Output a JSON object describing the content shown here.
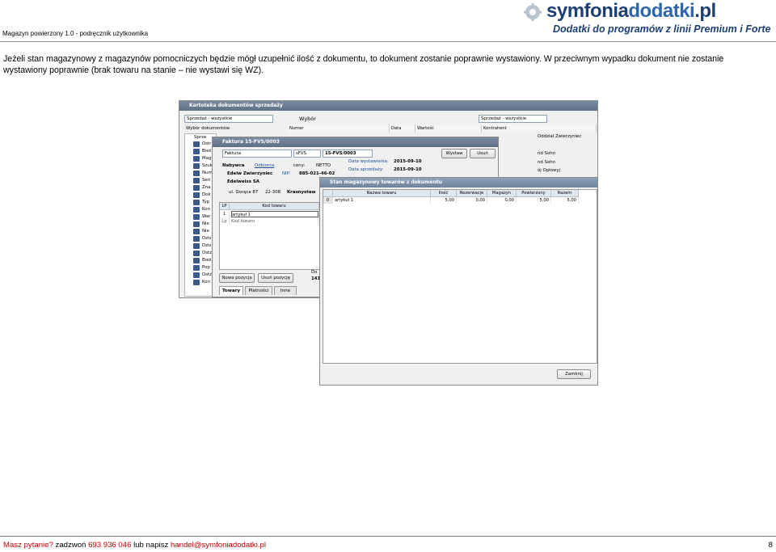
{
  "header": {
    "left_text": "Magazyn powierzony 1.0  - podręcznik użytkownika",
    "logo_main": "symfonia",
    "logo_accent": "dodatki",
    "logo_tld": ".pl",
    "logo_tagline": "Dodatki do programów z linii Premium i Forte"
  },
  "body": {
    "paragraph": "Jeżeli stan magazynowy z magazynów pomocniczych będzie mógł uzupełnić ilość z dokumentu, to dokument zostanie poprawnie wystawiony. W przeciwnym wypadku dokument nie zostanie wystawiony poprawnie (brak towaru na stanie – nie wystawi się WZ)."
  },
  "screenshot": {
    "kartoteka": {
      "title": "Kartoteka dokumentów sprzedaży",
      "filter_value": "Sprzedaż - wszystkie",
      "wybor_label": "Wybór dokumentów",
      "wybor_header": "Wybór",
      "wybor_value": "Sprzedaż - wszystkie",
      "columns": [
        "Numer",
        "Data",
        "Wartość",
        "Kontrahent"
      ],
      "right_entries": [
        "Oddział Zwierzyniec",
        "nd Sohn",
        "nd Sohn",
        "ój Opłowyj"
      ],
      "tree_items": [
        "Sprze",
        "Ostr",
        "Bież",
        "Mag",
        "Szuk",
        "Num",
        "Seri",
        "Zna",
        "Dok",
        "Typ",
        "Kon",
        "War",
        "Nie",
        "Nie",
        "Dzis",
        "Dzis",
        "Ostz",
        "Bież",
        "Pop",
        "Ostz",
        "Kon"
      ]
    },
    "faktura": {
      "title": "Faktura 15-FVS/0003",
      "type_value": "Faktura",
      "series_value": "sFVS",
      "number_value": "15-FVS/0003",
      "wystaw_label": "Wystaw",
      "usun_label": "Usuń",
      "nabywca_tab": "Nabywca",
      "odbiorca_tab": "Odbiorca",
      "ceny_label": "ceny:",
      "ceny_value": "NETTO",
      "customer_name": "Edelw Zwierzyniec",
      "nip_label": "NIP:",
      "nip_value": "885-021-46-02",
      "customer_name2": "Edelweiss SA",
      "address": "ul. Gorąca 87",
      "postcode": "22-308",
      "city": "Krasnystaw",
      "data_wystawienia_label": "Data wystawienia:",
      "data_wystawienia_value": "2015-09-10",
      "data_sprzedazy_label": "Data sprzedaży:",
      "data_sprzedazy_value": "2015-09-10",
      "items_header_lp": "LP",
      "items_header_kod": "Kod towaru",
      "items": [
        {
          "lp": "1",
          "kod": "artykuł 1"
        },
        {
          "lp": "Lp",
          "kod": "Kod towaru"
        }
      ],
      "nowa_pozycja": "Nowa pozycja",
      "usun_pozycje": "Usuń pozycję",
      "tabs": [
        "Towary",
        "Płatności",
        "Inne"
      ],
      "right_fragment_1": "Do",
      "right_fragment_2": "141"
    },
    "stan": {
      "title": "Stan magazynowy towarów z dokumentu",
      "columns": [
        "",
        "Nazwa towaru",
        "Ilość",
        "Rezerwacje",
        "Magazyn",
        "Powierzony",
        "Razem"
      ],
      "rows": [
        {
          "lp": "0",
          "nazwa": "artykuł 1",
          "ilosc": "5,00",
          "rezerwacje": "0,00",
          "magazyn": "0,00",
          "powierzony": "5,00",
          "razem": "5,00"
        }
      ],
      "zamknij": "Zamknij"
    }
  },
  "footer": {
    "question": "Masz pytanie?",
    "call": " zadzwoń ",
    "phone": "693 936 046",
    "or_write": " lub napisz ",
    "email": "handel@symfoniadodatki.pl",
    "page_number": "8"
  }
}
